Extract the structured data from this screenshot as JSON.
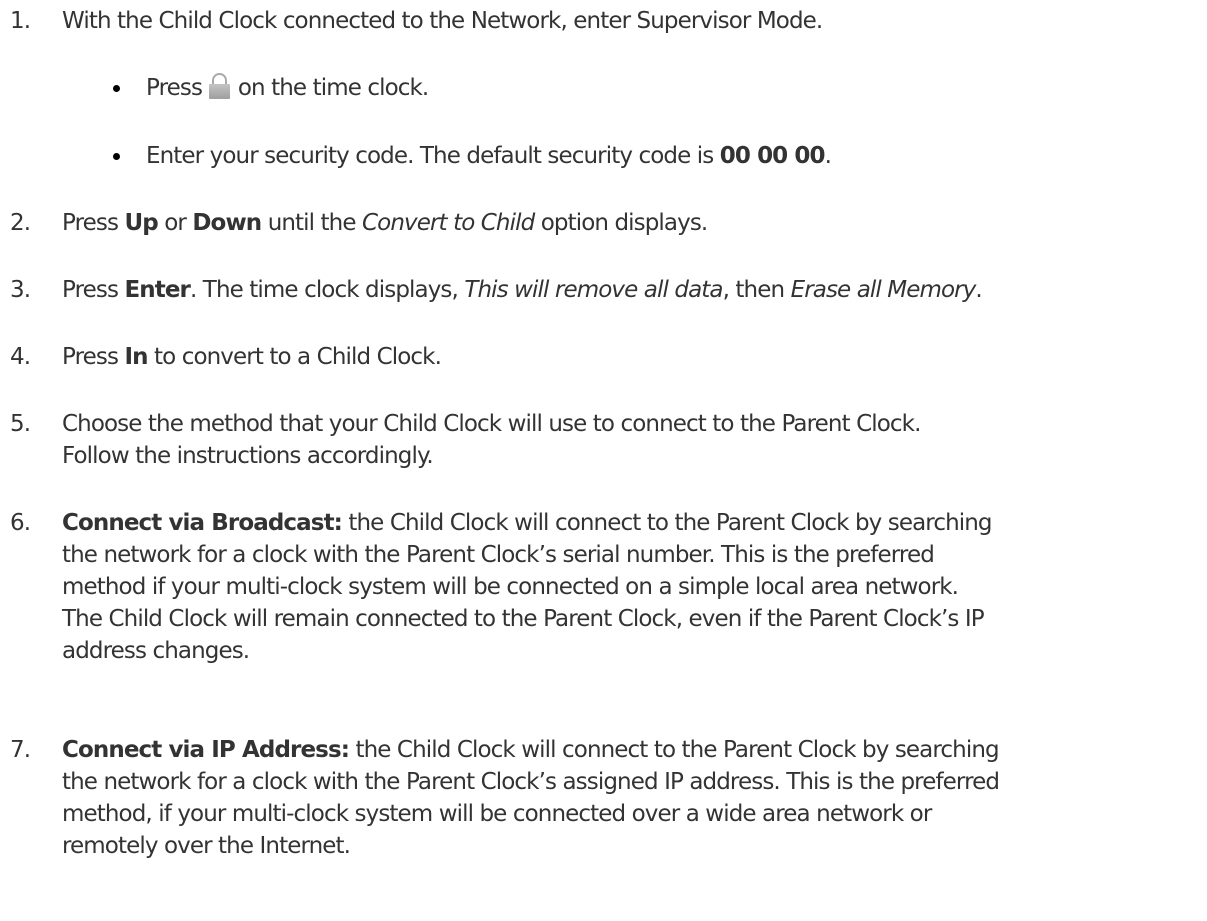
{
  "steps": [
    {
      "num": "1.",
      "text": "With the Child Clock connected to the Network, enter Supervisor Mode."
    },
    {
      "num": "2.",
      "t1": "Press ",
      "b1": "Up",
      "t2": " or ",
      "b2": "Down",
      "t3": " until the ",
      "i1": "Convert to Child",
      "t4": " option displays."
    },
    {
      "num": "3.",
      "t1": "Press ",
      "b1": "Enter",
      "t2": ". The time clock displays, ",
      "i1": "This will remove all data",
      "t3": ", then ",
      "i2": "Erase all Memory",
      "t4": "."
    },
    {
      "num": "4.",
      "t1": "Press ",
      "b1": "In",
      "t2": " to convert to a Child Clock."
    },
    {
      "num": "5.",
      "line1": "Choose the method that your Child Clock will use to connect to the Parent Clock.",
      "line2": "Follow the instructions accordingly."
    },
    {
      "num": "6.",
      "b1": "Connect via Broadcast:",
      "lines": [
        " the Child Clock will connect to the Parent Clock by searching",
        "the network for a clock with the Parent Clock’s serial number. This is the preferred",
        "method if your multi-clock system will be connected on a simple local area network.",
        "The Child Clock will remain connected to the Parent Clock, even if the Parent Clock’s IP",
        "address changes."
      ]
    },
    {
      "num": "7.",
      "b1": "Connect via IP Address:",
      "lines": [
        " the Child Clock will connect to the Parent Clock by searching",
        "the network for a clock with the Parent Clock’s assigned IP address. This is the preferred",
        "method, if your multi-clock system will be connected over a wide area network or",
        "remotely over the Internet."
      ]
    }
  ],
  "bullets": [
    {
      "t1": "Press ",
      "icon": "lock-icon",
      "t2": " on the time clock."
    },
    {
      "t1": "Enter your security code. The default security code is ",
      "b1": "00 00 00",
      "t2": "."
    }
  ]
}
